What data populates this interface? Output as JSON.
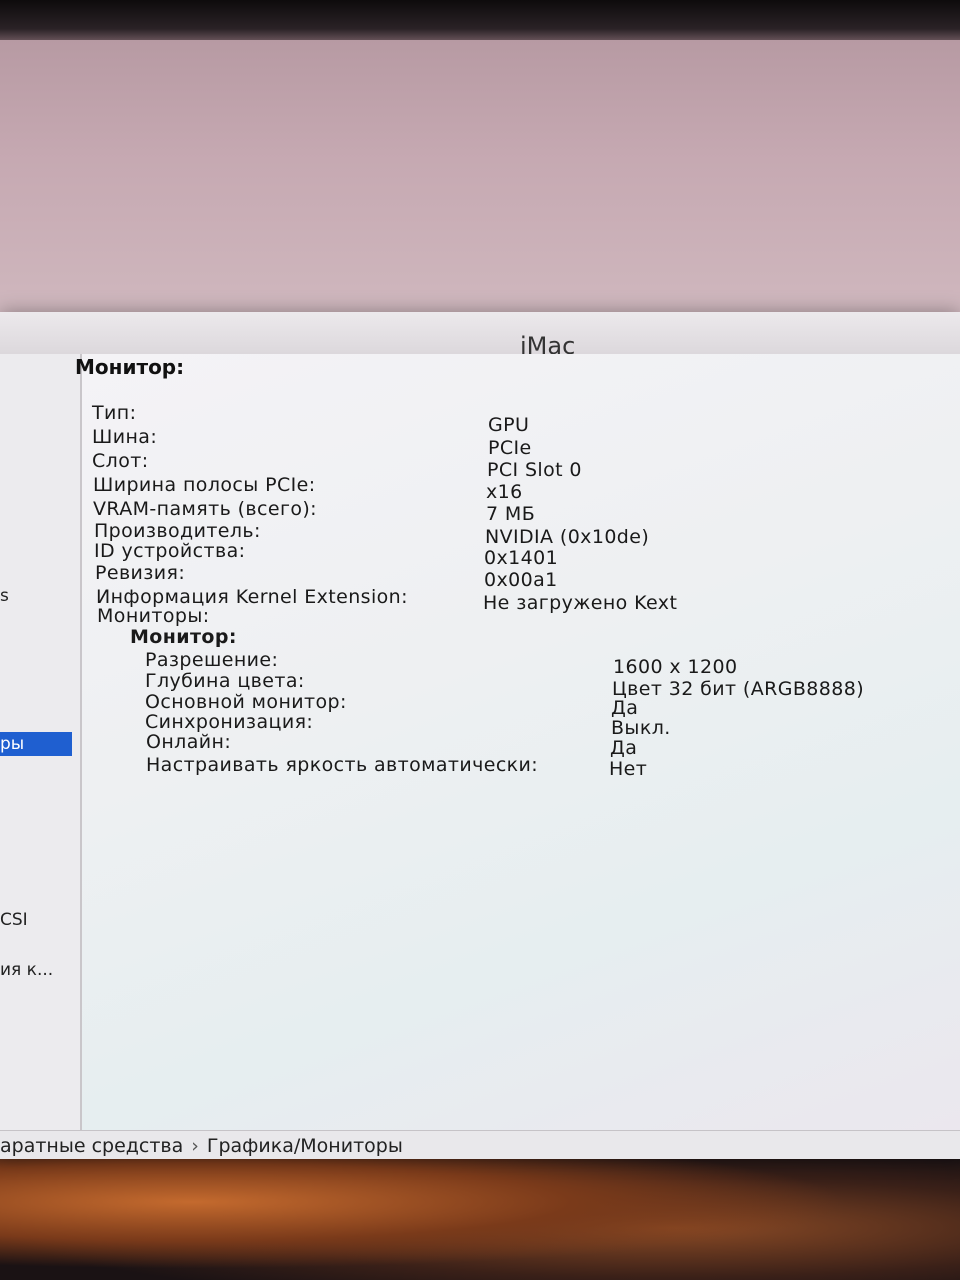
{
  "window": {
    "title": "iMac"
  },
  "sidebar": {
    "items": [
      {
        "label": "s"
      },
      {
        "label": "ры",
        "selected": true
      },
      {
        "label": "CSI"
      },
      {
        "label": "ия к..."
      }
    ]
  },
  "content": {
    "section_title": "Монитор:",
    "properties": [
      {
        "label": "Тип:",
        "value": "GPU"
      },
      {
        "label": "Шина:",
        "value": "PCIe"
      },
      {
        "label": "Слот:",
        "value": "PCI Slot 0"
      },
      {
        "label": "Ширина полосы PCIe:",
        "value": "x16"
      },
      {
        "label": "VRAM-память (всего):",
        "value": "7 МБ"
      },
      {
        "label": "Производитель:",
        "value": "NVIDIA (0x10de)"
      },
      {
        "label": "ID устройства:",
        "value": "0x1401"
      },
      {
        "label": "Ревизия:",
        "value": "0x00a1"
      },
      {
        "label": "Информация Kernel Extension:",
        "value": "Не загружено Kext"
      },
      {
        "label": "Мониторы:",
        "value": ""
      }
    ],
    "monitor_subtitle": "Монитор:",
    "monitor_properties": [
      {
        "label": "Разрешение:",
        "value": "1600 x 1200"
      },
      {
        "label": "Глубина цвета:",
        "value": "Цвет 32 бит (ARGB8888)"
      },
      {
        "label": "Основной монитор:",
        "value": "Да"
      },
      {
        "label": "Синхронизация:",
        "value": "Выкл."
      },
      {
        "label": "Онлайн:",
        "value": "Да"
      },
      {
        "label": "Настраивать яркость автоматически:",
        "value": "Нет"
      }
    ]
  },
  "pathbar": {
    "part1": "аратные средства",
    "separator": "›",
    "part2": "Графика/Мониторы"
  },
  "colors": {
    "selection": "#1f5fd0",
    "window_bg": "#f2f1f3"
  }
}
